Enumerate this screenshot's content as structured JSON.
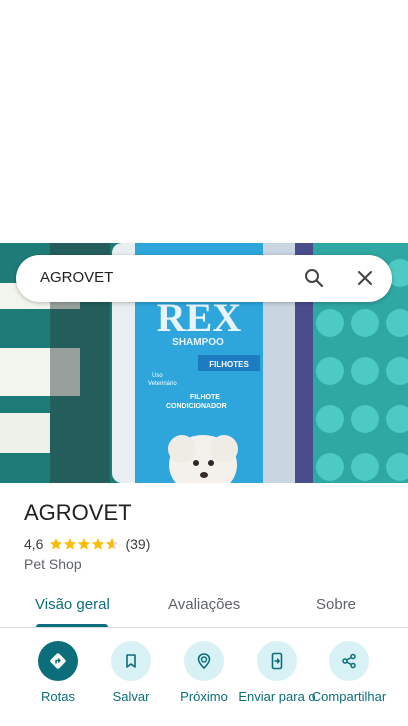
{
  "search": {
    "query": "AGROVET"
  },
  "photo": {
    "brand_text": "REX",
    "brand_sub": "SHAMPOO",
    "label_1": "FILHOTES",
    "label_2": "FILHOTE",
    "label_3": "CONDICIONADOR",
    "label_4": "Uso",
    "label_5": "Veterinário"
  },
  "place": {
    "name": "AGROVET",
    "rating": "4,6",
    "rating_value": 4.6,
    "review_count": "(39)",
    "category": "Pet Shop"
  },
  "tabs": [
    {
      "label": "Visão geral",
      "active": true
    },
    {
      "label": "Avaliações",
      "active": false
    },
    {
      "label": "Sobre",
      "active": false
    }
  ],
  "actions": [
    {
      "label": "Rotas",
      "icon": "directions-icon"
    },
    {
      "label": "Salvar",
      "icon": "bookmark-icon"
    },
    {
      "label": "Próximo",
      "icon": "nearby-icon"
    },
    {
      "label": "Enviar para o",
      "icon": "send-to-phone-icon"
    },
    {
      "label": "Compartilhar",
      "icon": "share-icon"
    }
  ],
  "colors": {
    "accent": "#0b6e7a",
    "accent_light": "#d8f1f4",
    "star": "#fbbc04"
  }
}
